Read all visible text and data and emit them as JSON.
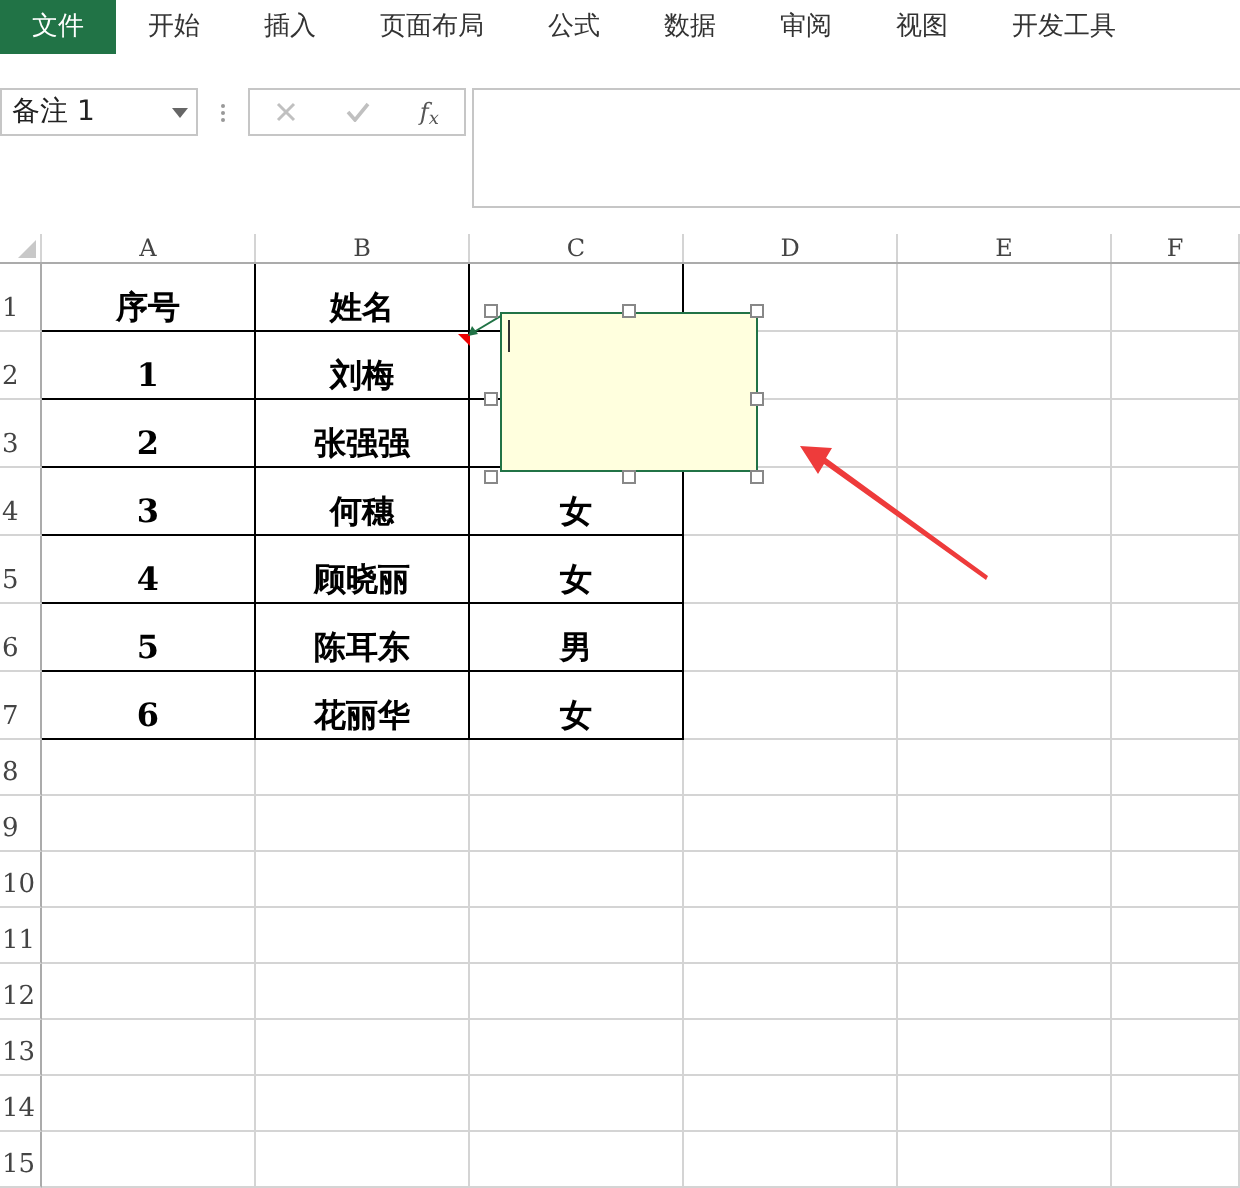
{
  "ribbon_tabs": [
    {
      "label": "文件",
      "selected": true
    },
    {
      "label": "开始",
      "selected": false
    },
    {
      "label": "插入",
      "selected": false
    },
    {
      "label": "页面布局",
      "selected": false
    },
    {
      "label": "公式",
      "selected": false
    },
    {
      "label": "数据",
      "selected": false
    },
    {
      "label": "审阅",
      "selected": false
    },
    {
      "label": "视图",
      "selected": false
    },
    {
      "label": "开发工具",
      "selected": false
    }
  ],
  "name_box": {
    "value": "备注 1"
  },
  "formula_bar": {
    "function_label": "f$_{x}$"
  },
  "columns": [
    "A",
    "B",
    "C",
    "D",
    "E",
    "F"
  ],
  "rows": [
    {
      "header": "1",
      "cells": [
        "序号",
        "姓名"
      ]
    },
    {
      "header": "2",
      "cells": [
        "1",
        "刘梅"
      ]
    },
    {
      "header": "3",
      "cells": [
        "2",
        "张强强"
      ]
    },
    {
      "header": "4",
      "cells": [
        "3",
        "何穗",
        "女"
      ]
    },
    {
      "header": "5",
      "cells": [
        "4",
        "顾晓丽",
        "女"
      ]
    },
    {
      "header": "6",
      "cells": [
        "5",
        "陈耳东",
        "男"
      ]
    },
    {
      "header": "7",
      "cells": [
        "6",
        "花丽华",
        "女"
      ]
    },
    {
      "header": "8",
      "cells": []
    },
    {
      "header": "9",
      "cells": []
    },
    {
      "header": "10",
      "cells": []
    },
    {
      "header": "11",
      "cells": []
    },
    {
      "header": "12",
      "cells": []
    },
    {
      "header": "13",
      "cells": []
    },
    {
      "header": "14",
      "cells": []
    },
    {
      "header": "15",
      "cells": []
    }
  ],
  "comment": {
    "editing": true
  }
}
